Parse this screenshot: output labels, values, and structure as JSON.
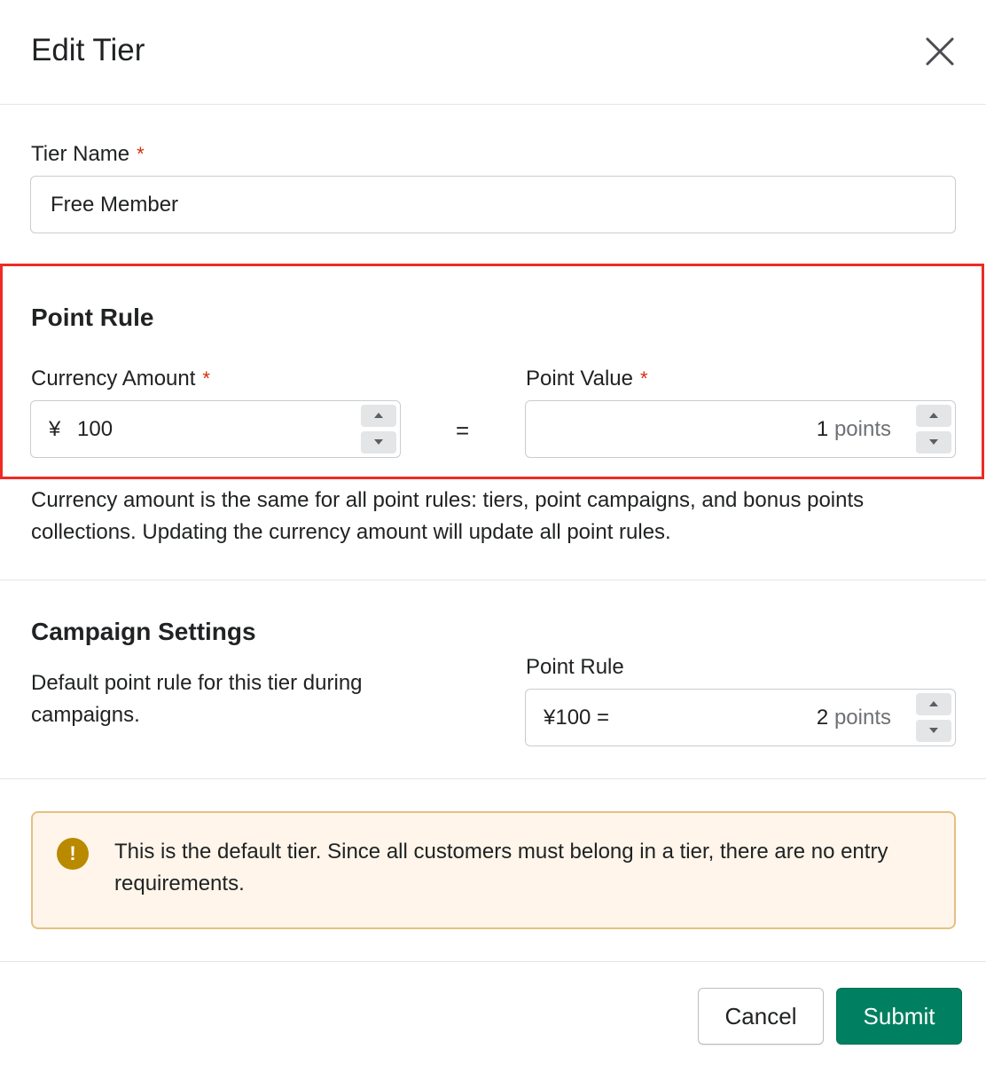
{
  "modal": {
    "title": "Edit Tier"
  },
  "tier_name": {
    "label": "Tier Name",
    "required_mark": "*",
    "value": "Free Member"
  },
  "point_rule": {
    "heading": "Point Rule",
    "currency_amount": {
      "label": "Currency Amount",
      "required_mark": "*",
      "prefix": "¥",
      "value": "100"
    },
    "equals": "=",
    "point_value": {
      "label": "Point Value",
      "required_mark": "*",
      "value": "1",
      "suffix": "points"
    },
    "help_text": "Currency amount is the same for all point rules: tiers, point campaigns, and bonus points collections. Updating the currency amount will update all point rules."
  },
  "campaign_settings": {
    "heading": "Campaign Settings",
    "description": "Default point rule for this tier during campaigns.",
    "point_rule": {
      "label": "Point Rule",
      "prefix": "¥100 =",
      "value": "2",
      "suffix": "points"
    }
  },
  "banner": {
    "icon": "!",
    "text": "This is the default tier. Since all customers must belong in a tier, there are no entry requirements."
  },
  "footer": {
    "cancel_label": "Cancel",
    "submit_label": "Submit"
  },
  "colors": {
    "primary": "#008060",
    "required": "#d72c0d",
    "highlight": "#ee2b24",
    "warning_bg": "#fff5ea",
    "warning_icon": "#b98900"
  }
}
